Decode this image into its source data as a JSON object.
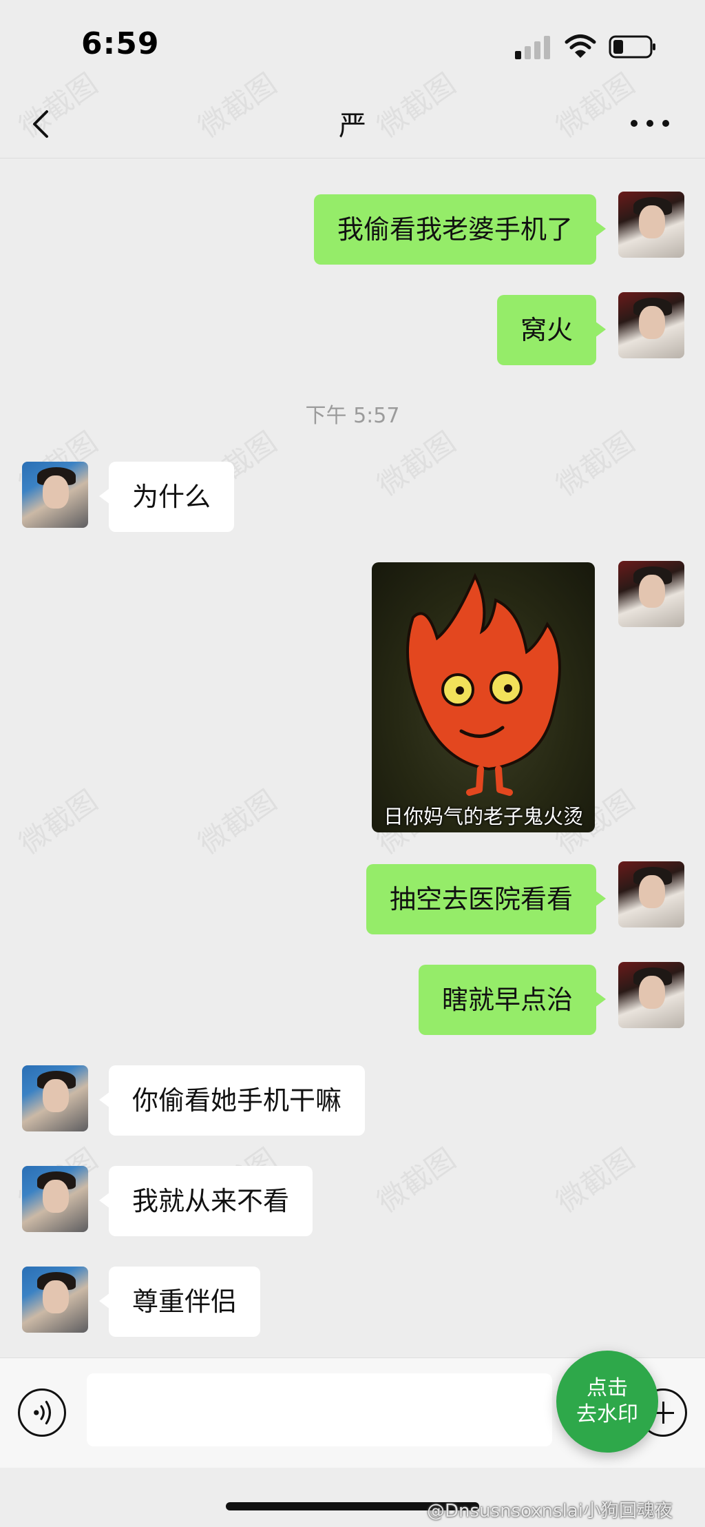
{
  "status_bar": {
    "time": "6:59",
    "signal_icon": "signal-icon",
    "wifi_icon": "wifi-icon",
    "battery_icon": "battery-icon"
  },
  "nav": {
    "back_icon": "chevron-left-icon",
    "title": "严",
    "more_icon": "more-dots-icon"
  },
  "messages": [
    {
      "sender": "me",
      "text": "我偷看我老婆手机了"
    },
    {
      "sender": "me",
      "text": "窝火"
    },
    {
      "sender": "other",
      "text": "为什么"
    },
    {
      "sender": "me",
      "type": "sticker",
      "caption": "日你妈气的老子鬼火烫"
    },
    {
      "sender": "me",
      "text": "抽空去医院看看"
    },
    {
      "sender": "me",
      "text": "瞎就早点治"
    },
    {
      "sender": "other",
      "text": "你偷看她手机干嘛"
    },
    {
      "sender": "other",
      "text": "我就从来不看"
    },
    {
      "sender": "other",
      "text": "尊重伴侣"
    }
  ],
  "timestamp": "下午 5:57",
  "input_bar": {
    "voice_icon": "voice-icon",
    "placeholder": "",
    "plus_icon": "plus-icon"
  },
  "watermark": {
    "button_line1": "点击",
    "button_line2": "去水印",
    "overlay_text": "微截图"
  },
  "credit": "@Dnsusnsoxnslai小狗回魂夜",
  "colors": {
    "bubble_me": "#95ec69",
    "bubble_other": "#ffffff",
    "background": "#ededed",
    "watermark_button": "#2ea84a"
  }
}
